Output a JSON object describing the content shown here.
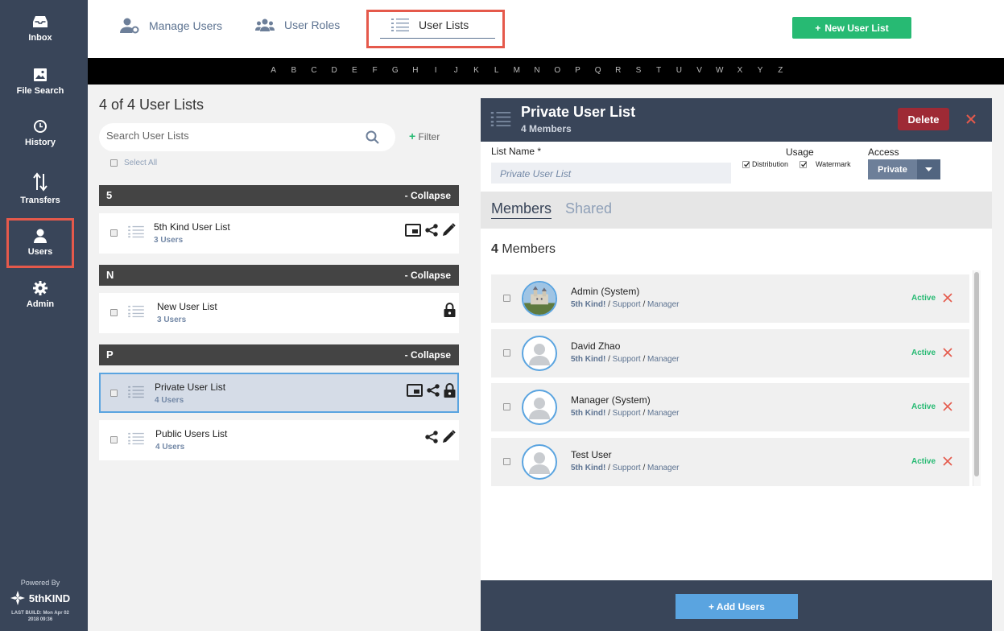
{
  "sidebar": {
    "items": [
      {
        "label": "Inbox",
        "icon": "inbox-icon"
      },
      {
        "label": "File Search",
        "icon": "image-icon"
      },
      {
        "label": "History",
        "icon": "clock-icon"
      },
      {
        "label": "Transfers",
        "icon": "transfer-arrows-icon"
      },
      {
        "label": "Users",
        "icon": "user-icon"
      },
      {
        "label": "Admin",
        "icon": "gear-icon"
      }
    ],
    "powered_by": "Powered By",
    "brand": "5thKIND",
    "build_line1": "LAST BUILD: Mon Apr 02",
    "build_line2": "2018 09:36"
  },
  "topnav": {
    "tabs": [
      {
        "label": "Manage Users",
        "icon": "user-cog-icon"
      },
      {
        "label": "User Roles",
        "icon": "users-group-icon"
      },
      {
        "label": "User Lists",
        "icon": "list-icon"
      }
    ],
    "active_tab": "User Lists",
    "new_button": "New User List"
  },
  "alphabet": [
    "A",
    "B",
    "C",
    "D",
    "E",
    "F",
    "G",
    "H",
    "I",
    "J",
    "K",
    "L",
    "M",
    "N",
    "O",
    "P",
    "Q",
    "R",
    "S",
    "T",
    "U",
    "V",
    "W",
    "X",
    "Y",
    "Z"
  ],
  "left": {
    "count_label": "4 of 4 User Lists",
    "search_placeholder": "Search User Lists",
    "filter_label": "Filter",
    "select_all": "Select All",
    "collapse_label": "- Collapse",
    "groups": [
      {
        "letter": "5"
      },
      {
        "letter": "N"
      },
      {
        "letter": "P"
      }
    ],
    "lists": [
      {
        "title": "5th Kind User List",
        "sub": "3 Users"
      },
      {
        "title": "New User List",
        "sub": "3 Users"
      },
      {
        "title": "Private User List",
        "sub": "4 Users"
      },
      {
        "title": "Public Users List",
        "sub": "4 Users"
      }
    ]
  },
  "detail": {
    "title": "Private User List",
    "subtitle": "4 Members",
    "delete_label": "Delete",
    "list_name_label": "List Name *",
    "list_name_value": "Private User List",
    "usage_label": "Usage",
    "usage_options": [
      "Distribution",
      "Watermark"
    ],
    "access_label": "Access",
    "access_value": "Private",
    "tabs": [
      "Members",
      "Shared"
    ],
    "members_count": "4",
    "members_word": "Members",
    "members": [
      {
        "name": "Admin (System)",
        "org": "5th Kind!",
        "sep1": "/",
        "team": "Support",
        "sep2": "/",
        "role": "Manager",
        "status": "Active"
      },
      {
        "name": "David Zhao",
        "org": "5th Kind!",
        "sep1": "/",
        "team": "Support",
        "sep2": "/",
        "role": "Manager",
        "status": "Active"
      },
      {
        "name": "Manager (System)",
        "org": "5th Kind!",
        "sep1": "/",
        "team": "Support",
        "sep2": "/",
        "role": "Manager",
        "status": "Active"
      },
      {
        "name": "Test User",
        "org": "5th Kind!",
        "sep1": "/",
        "team": "Support",
        "sep2": "/",
        "role": "Manager",
        "status": "Active"
      }
    ],
    "add_users_label": "+ Add Users"
  },
  "colors": {
    "sidebar": "#394559",
    "accent_green": "#27ba73",
    "accent_blue": "#5aa4e0",
    "delete_red": "#9e2a35",
    "highlight_frame": "#e5594b"
  }
}
